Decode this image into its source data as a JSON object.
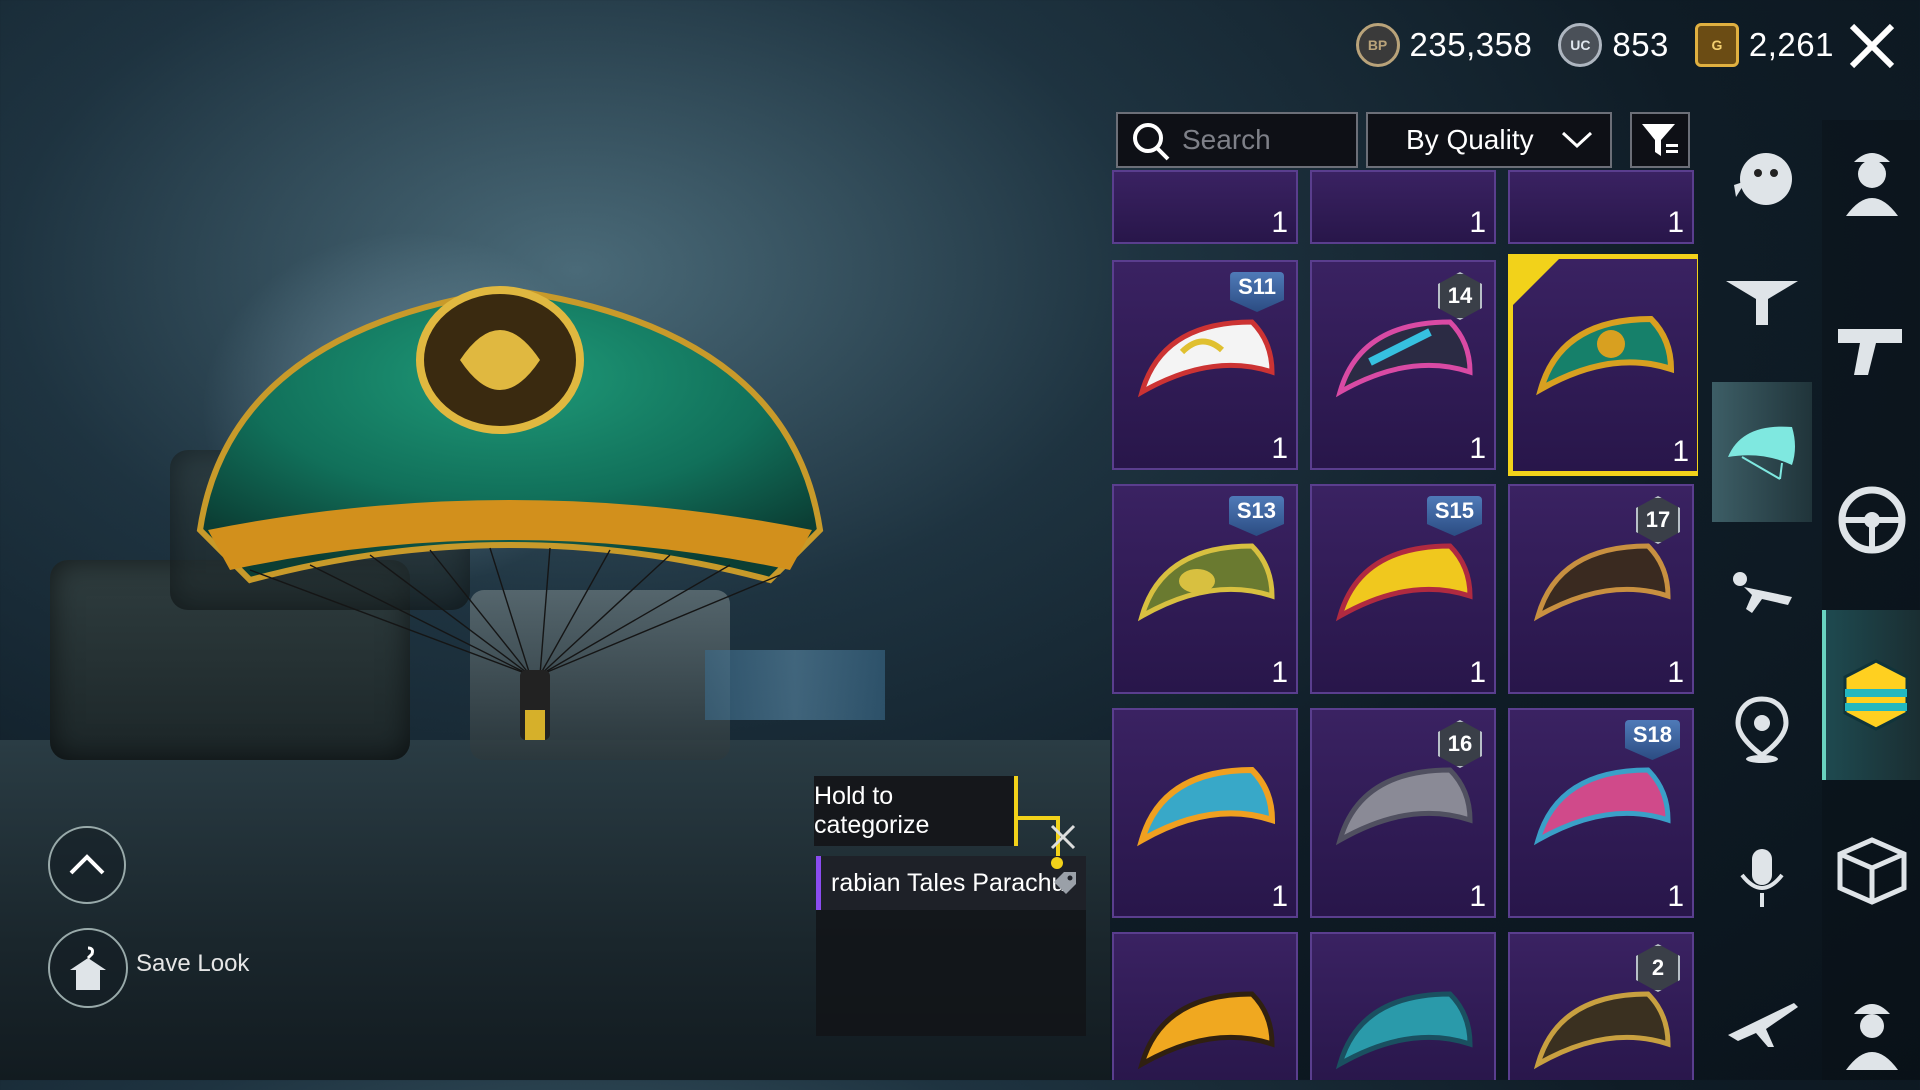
{
  "currency": {
    "bp_icon": "bp-coin-icon",
    "bp_value": "235,358",
    "uc_icon": "uc-coin-icon",
    "uc_value": "853",
    "g_icon": "g-coin-icon",
    "g_value": "2,261"
  },
  "toolbar": {
    "search_placeholder": "Search",
    "sort_value": "By Quality"
  },
  "preview": {
    "hold_tip": "Hold to categorize",
    "item_name": "rabian Tales Parachu",
    "save_look_label": "Save Look"
  },
  "grid": {
    "rows": [
      [
        {
          "count": "1"
        },
        {
          "count": "1"
        },
        {
          "count": "1"
        }
      ],
      [
        {
          "badge": "S11",
          "count": "1"
        },
        {
          "badge": "14",
          "count": "1"
        },
        {
          "badge": "",
          "count": "1",
          "selected": true
        }
      ],
      [
        {
          "badge": "S13",
          "count": "1"
        },
        {
          "badge": "S15",
          "count": "1"
        },
        {
          "badge": "17",
          "count": "1"
        }
      ],
      [
        {
          "badge": "",
          "count": "1"
        },
        {
          "badge": "16",
          "count": "1"
        },
        {
          "badge": "S18",
          "count": "1"
        }
      ],
      [
        {
          "badge": "",
          "count": ""
        },
        {
          "badge": "",
          "count": ""
        },
        {
          "badge": "2",
          "count": ""
        }
      ]
    ]
  },
  "colors": {
    "accent": "#f2d21a",
    "card_bg": "#2f1b55",
    "active_tab": "#69d3c0"
  }
}
